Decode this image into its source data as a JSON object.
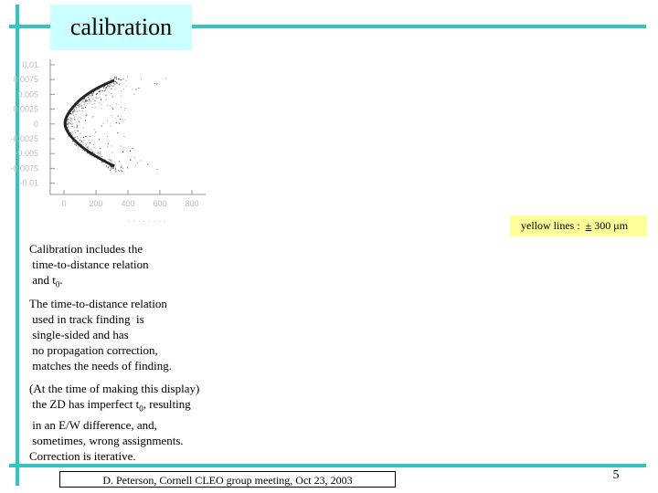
{
  "slide": {
    "title": "calibration",
    "legend": {
      "prefix": "yellow lines :",
      "pm": "±",
      "value": "300 μm"
    },
    "plot": {
      "y_ticks": [
        "0.01",
        "0.0075",
        "0.005",
        "0.0025",
        "0",
        "-0.0025",
        "-0.005",
        "-0.0075",
        "-0.01"
      ],
      "x_ticks": [
        "0",
        "200",
        "400",
        "600",
        "800"
      ]
    },
    "paragraphs": [
      {
        "lines": [
          "Calibration includes the",
          " time-to-distance relation",
          " and t"
        ],
        "sub": "0",
        "tail": "."
      },
      {
        "lines": [
          "The time-to-distance relation",
          " used in track finding  is",
          " single-sided and has",
          " no propagation correction,",
          " matches the needs of finding."
        ]
      },
      {
        "line1": "(At the time of making this display)",
        "line2_pre": " the ZD has imperfect t",
        "line2_sub": "0",
        "line2_post": ", resulting",
        "lines": [
          " in an E/W difference, and,",
          " sometimes, wrong assignments.",
          "Correction is iterative."
        ]
      }
    ],
    "footer": "D. Peterson, Cornell CLEO group meeting, Oct 23, 2003",
    "page_number": "5",
    "colors": {
      "rule": "#33c4c4",
      "title_bg": "#ccffff",
      "legend_bg": "#ffff99"
    }
  }
}
